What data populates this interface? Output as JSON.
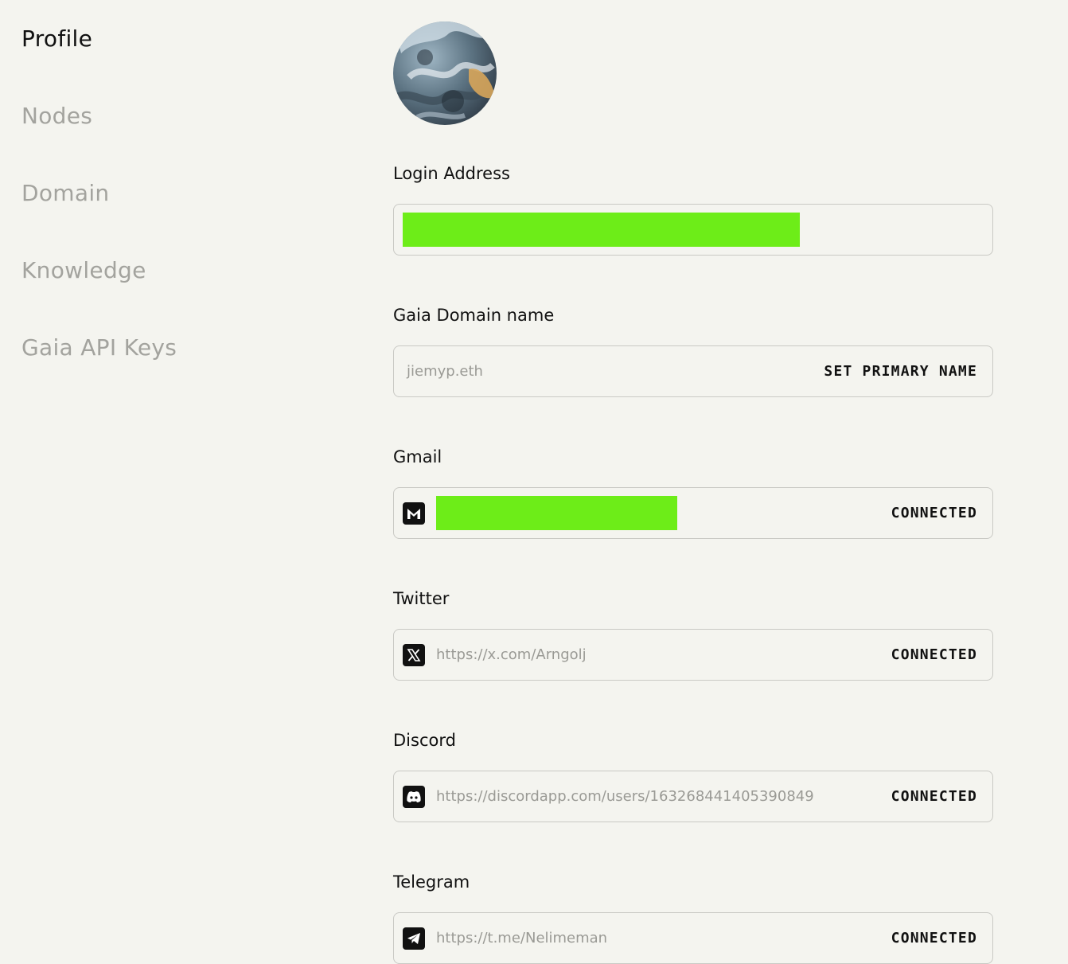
{
  "sidebar": {
    "items": [
      {
        "label": "Profile",
        "active": true
      },
      {
        "label": "Nodes"
      },
      {
        "label": "Domain"
      },
      {
        "label": "Knowledge"
      },
      {
        "label": "Gaia API Keys"
      }
    ]
  },
  "profile": {
    "login_address": {
      "label": "Login Address"
    },
    "domain": {
      "label": "Gaia Domain name",
      "value": "jiemyp.eth",
      "action": "SET PRIMARY NAME"
    },
    "gmail": {
      "label": "Gmail",
      "icon": "gmail-icon",
      "status": "CONNECTED"
    },
    "twitter": {
      "label": "Twitter",
      "icon": "x-icon",
      "value": "https://x.com/Arngolj",
      "status": "CONNECTED"
    },
    "discord": {
      "label": "Discord",
      "icon": "discord-icon",
      "value": "https://discordapp.com/users/163268441405390849",
      "status": "CONNECTED"
    },
    "telegram": {
      "label": "Telegram",
      "icon": "telegram-icon",
      "value": "https://t.me/Nelimeman",
      "status": "CONNECTED"
    }
  },
  "colors": {
    "background": "#f4f4ef",
    "redaction": "#6ded18",
    "muted_text": "#a3a39e",
    "border": "#c9c9c4"
  }
}
